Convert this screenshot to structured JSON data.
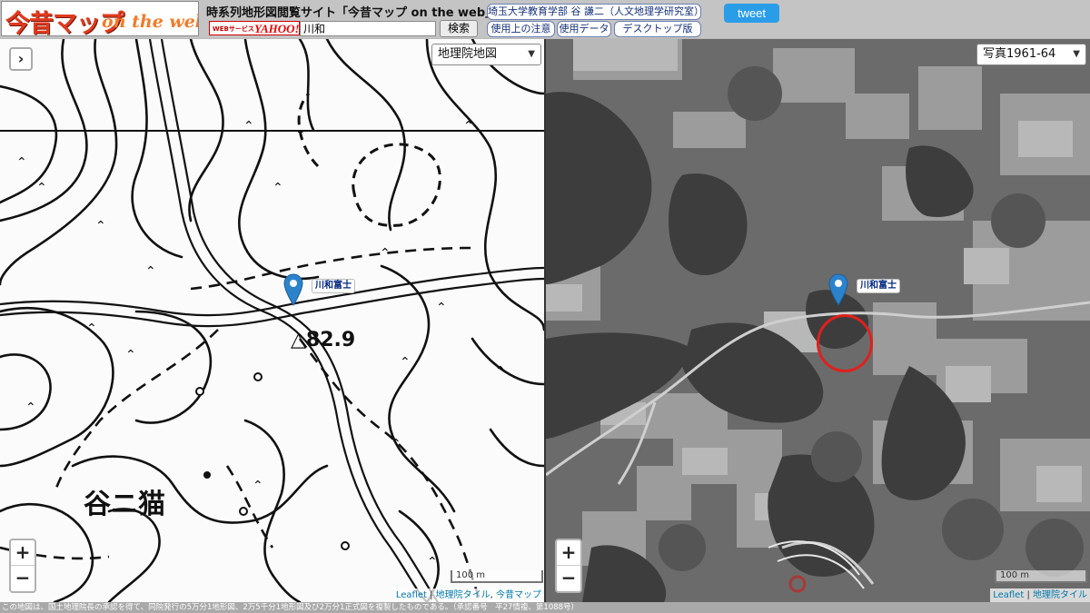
{
  "header": {
    "logo_text_ja": "今昔マップ",
    "logo_text_en": "on the web",
    "site_title": "時系列地形図閲覧サイト「今昔マップ on the web」",
    "yahoo_service_label": "WEBサービス",
    "yahoo_logo": "YAHOO!",
    "search_value": "川和",
    "search_button": "検索",
    "author_link": "埼玉大学教育学部 谷 謙二（人文地理学研究室）",
    "notes_link": "使用上の注意",
    "data_link": "使用データ",
    "desktop_link": "デスクトップ版",
    "tweet_button": "tweet"
  },
  "left_map": {
    "layer_select": "地理院地図",
    "toggle_icon": "chevron-right",
    "marker_label": "川和富士",
    "map_text_elevation": "△82.9",
    "map_text_place": "谷ニ猫",
    "zoom_in": "+",
    "zoom_out": "−",
    "scale_label": "100 m",
    "attribution": [
      "Leaflet",
      "地理院タイル",
      "今昔マップ"
    ]
  },
  "right_map": {
    "layer_select": "写真1961-64",
    "marker_label": "川和富士",
    "zoom_in": "+",
    "zoom_out": "−",
    "scale_label": "100 m",
    "attribution": [
      "Leaflet",
      "地理院タイル"
    ]
  },
  "footer": {
    "notice": "この地図は、国土地理院長の承認を得て、同院発行の5万分1地形図、2万5千分1地形図及び2万分1正式図を複製したものである。（承認番号　平27情複、第1088号）"
  },
  "colors": {
    "marker": "#2b83cb",
    "circle": "#e0201c",
    "tweet": "#2a9de8",
    "logo": "#e03a1e"
  }
}
